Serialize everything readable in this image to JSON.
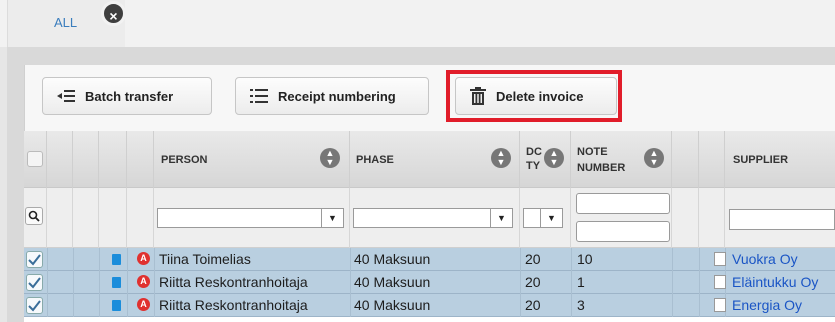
{
  "tab": {
    "label": "ALL",
    "close_icon": "×"
  },
  "toolbar": {
    "batch_label": "Batch transfer",
    "receipt_label": "Receipt numbering",
    "delete_label": "Delete invoice",
    "highlight_color": "#e11d2a"
  },
  "grid": {
    "headers": {
      "person": "PERSON",
      "phase": "PHASE",
      "doc_type": "DC TY",
      "note_number_1": "NOTE",
      "note_number_2": "NUMBER",
      "supplier": "SUPPLIER"
    },
    "rows": [
      {
        "checked": true,
        "person": "Tiina Toimelias",
        "phase": "40 Maksuun",
        "doc_type": "20",
        "note_number": "10",
        "supplier": "Vuokra Oy"
      },
      {
        "checked": true,
        "person": "Riitta Reskontranhoitaja",
        "phase": "40 Maksuun",
        "doc_type": "20",
        "note_number": "1",
        "supplier": "Eläintukku Oy"
      },
      {
        "checked": true,
        "person": "Riitta Reskontranhoitaja",
        "phase": "40 Maksuun",
        "doc_type": "20",
        "note_number": "3",
        "supplier": "Energia Oy"
      }
    ],
    "row_color": "#b9cfe0",
    "link_color": "#1a55c5"
  }
}
